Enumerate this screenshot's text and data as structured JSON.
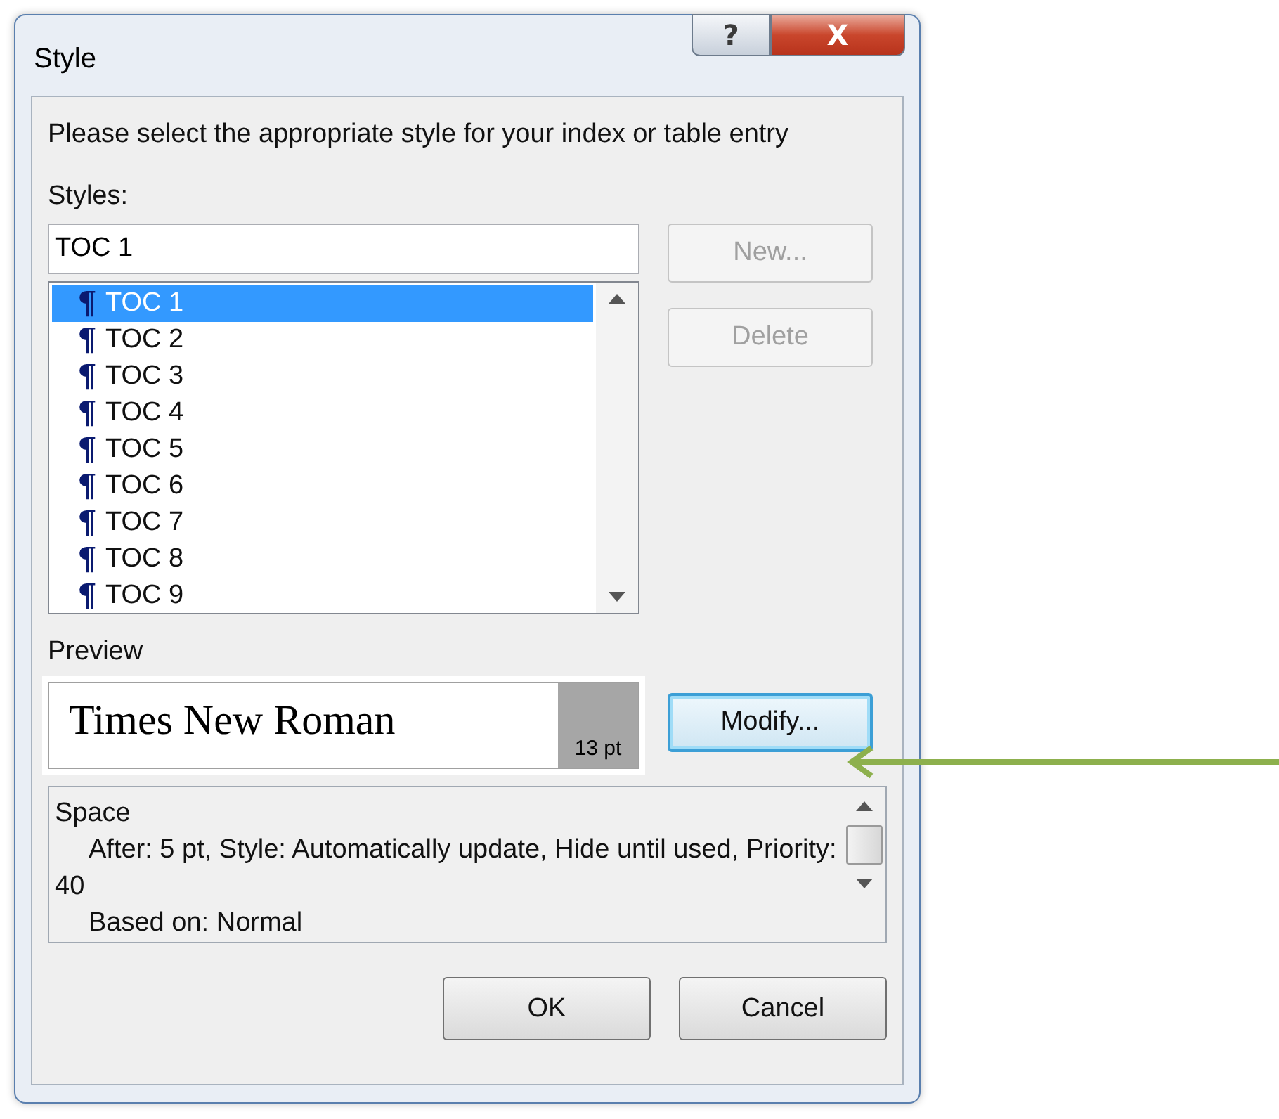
{
  "window": {
    "title": "Style",
    "help_button": "?",
    "close_button": "X"
  },
  "instruction": "Please select the appropriate style for your index or table entry",
  "styles_label": "Styles:",
  "style_field": {
    "value": "TOC 1"
  },
  "styles": [
    {
      "mark": "¶",
      "label": "TOC 1",
      "selected": true
    },
    {
      "mark": "¶",
      "label": "TOC 2",
      "selected": false
    },
    {
      "mark": "¶",
      "label": "TOC 3",
      "selected": false
    },
    {
      "mark": "¶",
      "label": "TOC 4",
      "selected": false
    },
    {
      "mark": "¶",
      "label": "TOC 5",
      "selected": false
    },
    {
      "mark": "¶",
      "label": "TOC 6",
      "selected": false
    },
    {
      "mark": "¶",
      "label": "TOC 7",
      "selected": false
    },
    {
      "mark": "¶",
      "label": "TOC 8",
      "selected": false
    },
    {
      "mark": "¶",
      "label": "TOC 9",
      "selected": false
    }
  ],
  "side_buttons": [
    {
      "label": "New...",
      "disabled": true
    },
    {
      "label": "Delete",
      "disabled": true
    }
  ],
  "preview_label": "Preview",
  "preview": {
    "font_name": "Times New Roman",
    "size": "13 pt"
  },
  "modify_button": {
    "label": "Modify...",
    "focused": true
  },
  "description": [
    {
      "text": "Space",
      "indented": false
    },
    {
      "text": "After:  5 pt, Style: Automatically update, Hide until used, Priority: 40",
      "indented": true
    },
    {
      "text": "Based on: Normal",
      "indented": true
    }
  ],
  "footer_buttons": [
    "OK",
    "Cancel"
  ]
}
